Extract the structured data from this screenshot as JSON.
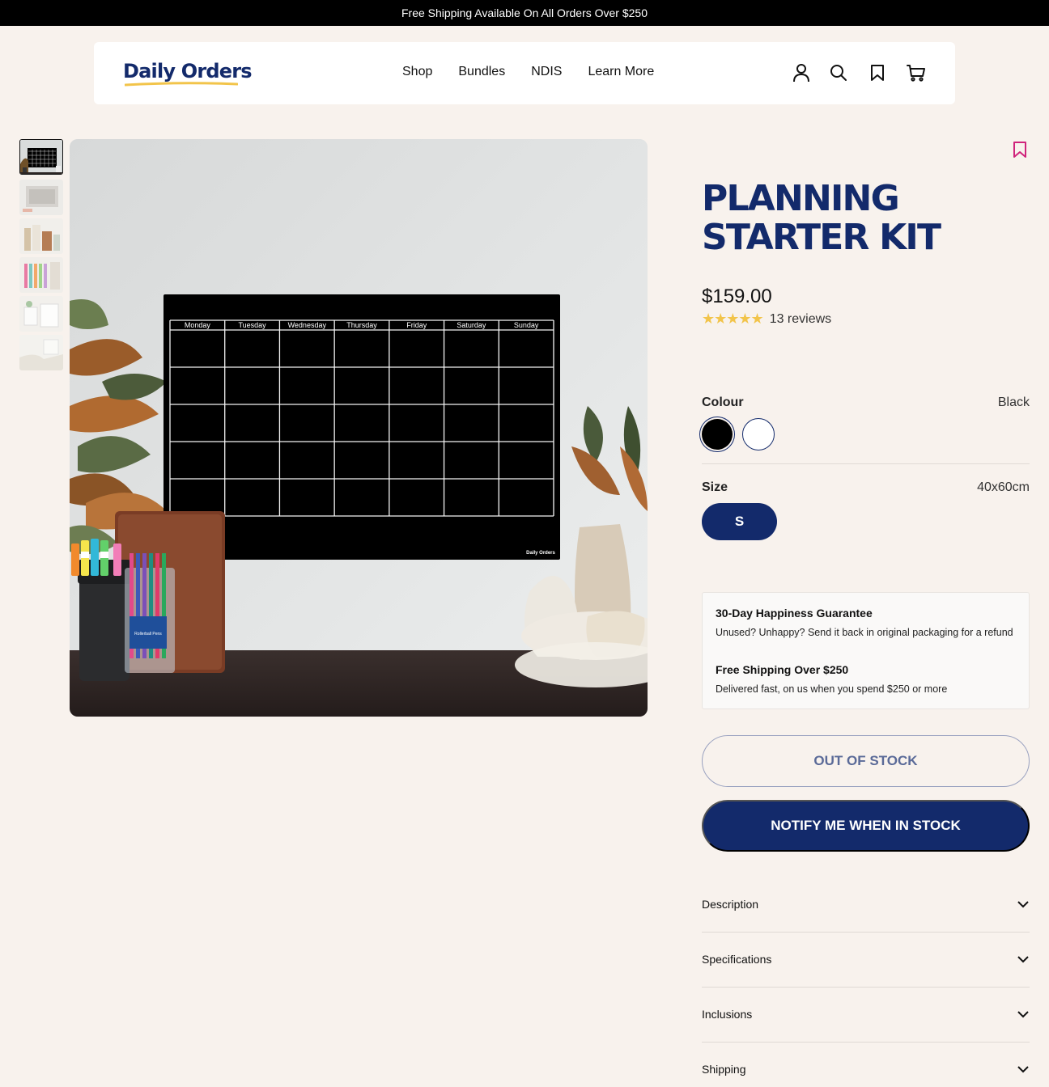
{
  "announcement": "Free Shipping Available On All Orders Over $250",
  "brand": {
    "name": "Daily Orders",
    "color": "#132a6b",
    "underline_color": "#f2c44a"
  },
  "nav": {
    "items": [
      "Shop",
      "Bundles",
      "NDIS",
      "Learn More"
    ]
  },
  "header_icons": [
    "account-icon",
    "search-icon",
    "wishlist-icon",
    "cart-icon"
  ],
  "gallery": {
    "thumbnail_count": 6,
    "main_image": {
      "description": "black glass monthly planner on wall",
      "days": [
        "Monday",
        "Tuesday",
        "Wednesday",
        "Thursday",
        "Friday",
        "Saturday",
        "Sunday"
      ],
      "board_brand": "Daily Orders",
      "product_label": "Rollerball Pens"
    }
  },
  "product": {
    "title_line1": "PLANNING",
    "title_line2": "STARTER KIT",
    "price": "$159.00",
    "stars": "★★★★★",
    "rating": 5,
    "reviews": "13 reviews",
    "colour": {
      "label": "Colour",
      "selected": "Black",
      "swatches": [
        "#000000",
        "#ffffff"
      ]
    },
    "size": {
      "label": "Size",
      "selected": "40x60cm",
      "option": "S"
    }
  },
  "guarantee": {
    "title1": "30-Day Happiness Guarantee",
    "text1": "Unused? Unhappy? Send it back in original packaging for a refund",
    "title2": "Free Shipping Over $250",
    "text2": "Delivered fast, on us when you spend $250 or more"
  },
  "buttons": {
    "out_of_stock": "OUT OF STOCK",
    "notify": "NOTIFY ME WHEN IN STOCK"
  },
  "accordion": [
    "Description",
    "Specifications",
    "Inclusions",
    "Shipping"
  ],
  "accent_colors": {
    "navy": "#132a6b",
    "wishlist": "#d0247c",
    "star": "#f2c44a"
  }
}
